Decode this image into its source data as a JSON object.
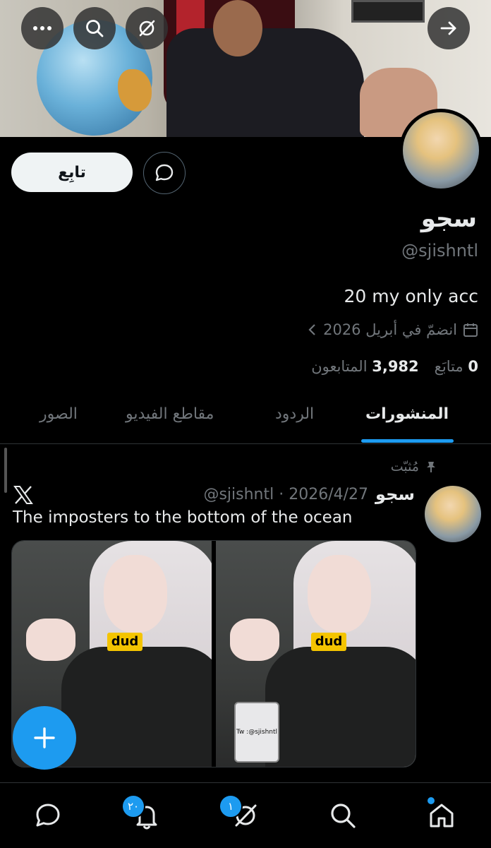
{
  "header": {
    "more_icon": "more-icon",
    "search_icon": "search-icon",
    "grok_icon": "grok-icon",
    "forward_icon": "arrow-right-icon"
  },
  "profile": {
    "follow_label": "تابِع",
    "display_name": "سجو",
    "handle": "@sjishntl",
    "bio": "20 my only acc",
    "joined": "انضمّ في أبريل 2026",
    "following_count": "0",
    "following_label": "متابَع",
    "followers_count": "3,982",
    "followers_label": "المتابعون"
  },
  "tabs": [
    {
      "label": "المنشورات",
      "active": true
    },
    {
      "label": "الردود",
      "active": false
    },
    {
      "label": "مقاطع الفيديو",
      "active": false
    },
    {
      "label": "الصور",
      "active": false
    }
  ],
  "post": {
    "pinned_label": "مُثبّت",
    "author_name": "سجو",
    "author_handle": "@sjishntl",
    "date": "2026/4/27",
    "text": "The imposters to the bottom of the ocean",
    "shirt_text": "dud",
    "tablet_text": "Tw :@sjishntl"
  },
  "nav": {
    "notifications_badge": "٢٠",
    "grok_badge": "١"
  },
  "colors": {
    "accent": "#1d9bf0",
    "background": "#000000",
    "text": "#e7e9ea",
    "muted": "#71767b"
  }
}
